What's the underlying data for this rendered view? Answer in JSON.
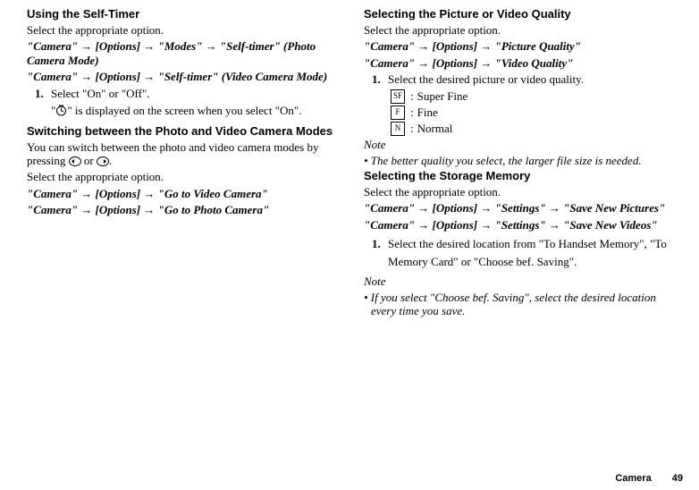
{
  "left": {
    "h1": "Using the Self-Timer",
    "selectopt": "Select the appropriate option.",
    "path1": "\"Camera\" → [Options] → \"Modes\" → \"Self-timer\" (Photo Camera Mode)",
    "path2": "\"Camera\" → [Options] → \"Self-timer\" (Video Camera Mode)",
    "step1": "Select \"On\" or \"Off\".",
    "sub1a": "\" \" is displayed on the screen when you select \"On\".",
    "sub1_pre": "\"",
    "sub1_post": "\" is displayed on the screen when you select \"On\".",
    "h2": "Switching between the Photo and Video Camera Modes",
    "body2": "You can switch between the photo and video camera modes by pressing ",
    "body2_or": " or ",
    "body2_end": ".",
    "selectopt2": "Select the appropriate option.",
    "path3": "\"Camera\" → [Options] → \"Go to Video Camera\"",
    "path4": "\"Camera\" → [Options] → \"Go to Photo Camera\""
  },
  "right": {
    "h1": "Selecting the Picture or Video Quality",
    "selectopt": "Select the appropriate option.",
    "path1": "\"Camera\" → [Options] → \"Picture Quality\"",
    "path2": "\"Camera\" → [Options] → \"Video Quality\"",
    "step1": "Select the desired picture or video quality.",
    "icons": [
      {
        "code": "SF",
        "label": "Super Fine"
      },
      {
        "code": "F",
        "label": "Fine"
      },
      {
        "code": "N",
        "label": "Normal"
      }
    ],
    "notehead": "Note",
    "note1": "• The better quality you select, the larger file size is needed.",
    "h2": "Selecting the Storage Memory",
    "selectopt2": "Select the appropriate option.",
    "path3": "\"Camera\" → [Options] → \"Settings\" → \"Save New Pictures\"",
    "path4": "\"Camera\" → [Options] → \"Settings\" → \"Save New Videos\"",
    "step2": "Select the desired location from \"To Handset Memory\", \"To Memory Card\" or \"Choose bef. Saving\".",
    "notehead2": "Note",
    "note2": "• If you select \"Choose bef. Saving\", select the desired location every time you save."
  },
  "footer": {
    "chapter": "Camera",
    "page": "49"
  }
}
